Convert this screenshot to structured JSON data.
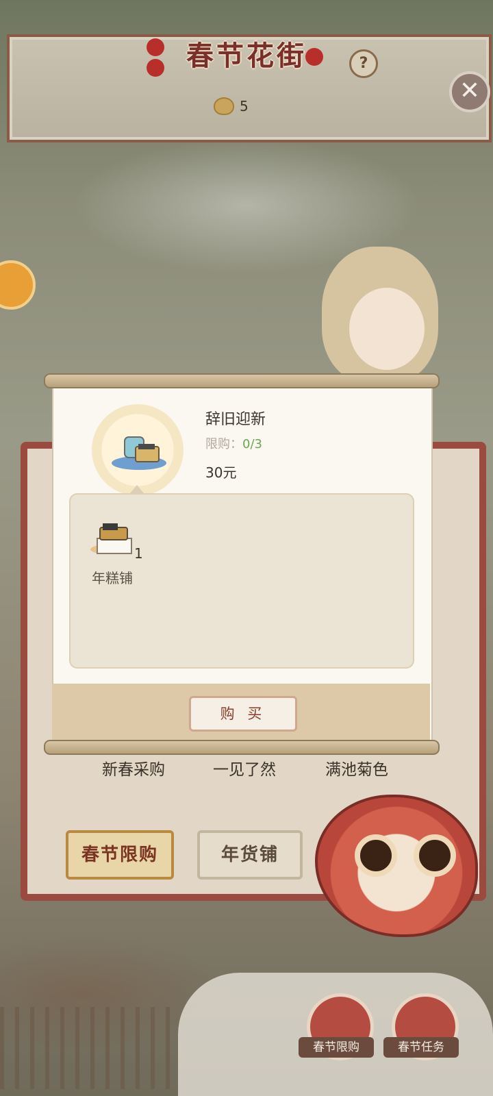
{
  "header": {
    "title": "春节花街",
    "help_symbol": "?",
    "close_symbol": "✕",
    "currency_count": "5"
  },
  "dialog": {
    "product_name": "辞旧迎新",
    "limit_label": "限购：",
    "limit_value": "0/3",
    "price": "30元",
    "reward": {
      "count": "1",
      "name": "年糕铺"
    },
    "buy_label": "购 买"
  },
  "shop": {
    "items": [
      {
        "name": "新春采购"
      },
      {
        "name": "一见了然"
      },
      {
        "name": "满池菊色"
      }
    ],
    "tabs": [
      {
        "label": "春节限购",
        "active": true
      },
      {
        "label": "年货铺",
        "active": false
      }
    ]
  },
  "bottom_buttons": [
    {
      "label": "春节限购",
      "icon": "gift-bag-icon"
    },
    {
      "label": "春节任务",
      "icon": "gift-bag-icon"
    }
  ],
  "colors": {
    "accent_red": "#9b4a3f",
    "limit_green": "#6aa84f",
    "title_red": "#7a2f2a"
  }
}
